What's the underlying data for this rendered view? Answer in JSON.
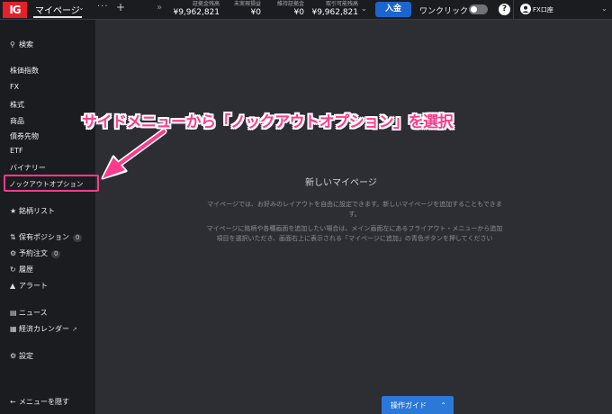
{
  "app": {
    "logo": "IG"
  },
  "tabs": {
    "active": "マイページ",
    "more": "···",
    "add": "+",
    "scroll": "»"
  },
  "stats": [
    {
      "label": "証拠金残高",
      "value": "¥9,962,821"
    },
    {
      "label": "未実現損益",
      "value": "¥0"
    },
    {
      "label": "維持証拠金",
      "value": "¥0"
    },
    {
      "label": "取引可能残高",
      "value": "¥9,962,821"
    }
  ],
  "header": {
    "deposit_label": "入金",
    "oneclick_label": "ワンクリック",
    "help": "?",
    "account_name": "FX口座"
  },
  "sidebar": {
    "search": "検索",
    "markets": [
      "株価指数",
      "FX",
      "株式",
      "商品",
      "債券先物",
      "ETF",
      "バイナリー",
      "ノックアウトオプション"
    ],
    "watchlist": "銘柄リスト",
    "positions": "保有ポジション",
    "positions_count": "0",
    "orders": "予約注文",
    "orders_count": "0",
    "history": "履歴",
    "alerts": "アラート",
    "news": "ニュース",
    "calendar": "経済カレンダー",
    "settings": "設定",
    "hide_menu": "メニューを隠す"
  },
  "main": {
    "title": "新しいマイページ",
    "desc1": "マイページでは、お好みのレイアウトを自由に設定できます。新しいマイページを追加することもできます。",
    "desc2": "マイページに銘柄や各種画面を追加したい場合は、メイン画面左にあるフライアウト・メニューから追加項目を選択いただき、画面右上に表示される「マイページに追加」の青色ボタンを押してください"
  },
  "guide": {
    "label": "操作ガイド"
  },
  "annotation": {
    "text": "サイドメニューから「ノックアウトオプション」を選択"
  },
  "colors": {
    "accent_blue": "#2b78d8",
    "brand_red": "#e4202a",
    "annotation_pink": "#ff3b8d"
  }
}
